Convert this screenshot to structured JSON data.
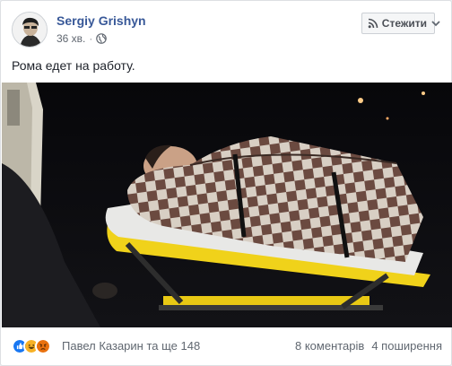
{
  "post": {
    "author": "Sergiy Grishyn",
    "time": "36 хв.",
    "separator": "·",
    "follow_label": "Стежити",
    "text": "Рома едет на работу."
  },
  "footer": {
    "reactors": "Павел Казарин та ще 148",
    "comments": "8 коментарів",
    "shares": "4 поширення"
  },
  "icons": {
    "privacy": "globe-icon",
    "follow": "rss-icon",
    "menu": "chevron-down-icon",
    "reactions": [
      "like-icon",
      "haha-icon",
      "angry-icon"
    ]
  },
  "colors": {
    "author": "#385898",
    "like": "#1877f2",
    "haha": "#f7b125",
    "angry": "#e9710f"
  }
}
